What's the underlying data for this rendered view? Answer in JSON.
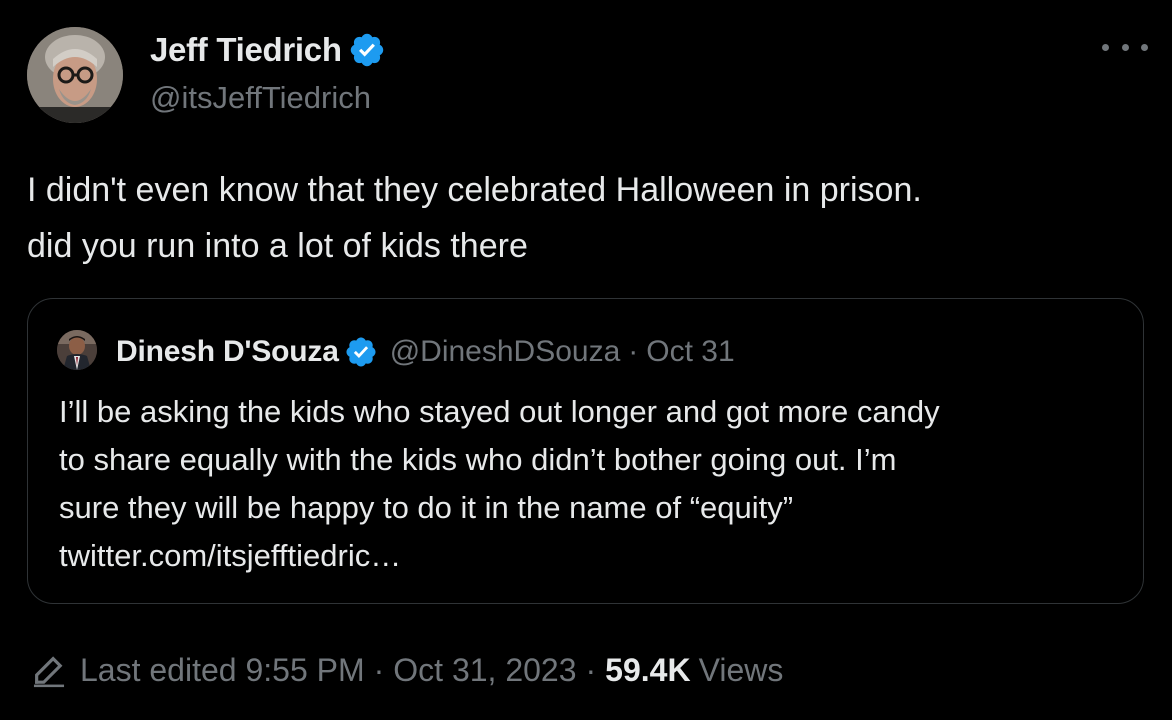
{
  "tweet": {
    "author": {
      "display_name": "Jeff Tiedrich",
      "handle": "@itsJeffTiedrich",
      "verified": true
    },
    "more_icon": "more-horizontal-icon",
    "text_lines": [
      "I didn't even know that they celebrated Halloween in prison.",
      "did you run into a lot of kids there"
    ],
    "quote": {
      "author": {
        "display_name": "Dinesh D'Souza",
        "handle": "@DineshDSouza",
        "verified": true
      },
      "separator": "·",
      "date": "Oct 31",
      "text_lines": [
        "I’ll be asking the kids who stayed out longer and got more candy",
        "to share equally with the kids who didn’t bother going out. I’m",
        "sure they will be happy to do it in the name of “equity”",
        "twitter.com/itsjefftiedric…"
      ]
    },
    "footer": {
      "edit_icon": "pencil-icon",
      "edited_label": "Last edited 9:55 PM",
      "sep1": "·",
      "date": "Oct 31, 2023",
      "sep2": "·",
      "views_count": "59.4K",
      "views_label": "Views"
    }
  },
  "colors": {
    "background": "#000000",
    "primary_text": "#e7e9ea",
    "secondary_text": "#71767b",
    "border": "#2f3336",
    "verified_badge": "#1d9bf0"
  }
}
